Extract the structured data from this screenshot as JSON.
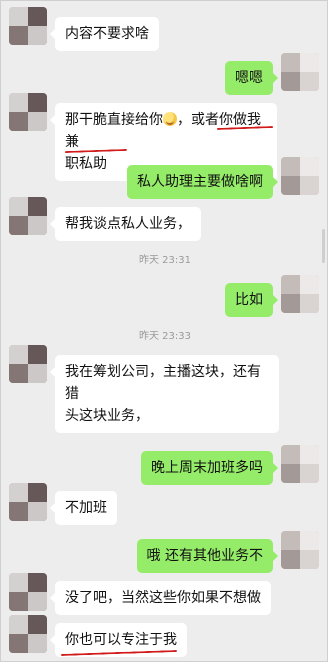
{
  "messages": [
    {
      "text": "内容不要求啥"
    },
    {
      "text": "嗯嗯"
    },
    {
      "line1_before_emoji": "那干脆直接给你",
      "line1_after_emoji": "，或者你做我兼",
      "line2": "职私助"
    },
    {
      "text": "私人助理主要做啥啊"
    },
    {
      "text": "帮我谈点私人业务，"
    },
    {
      "time": "昨天 23:31"
    },
    {
      "text": "比如"
    },
    {
      "time": "昨天 23:33"
    },
    {
      "line1": "我在筹划公司，主播这块，还有猎",
      "line2": "头这块业务，"
    },
    {
      "text": "晚上周末加班多吗"
    },
    {
      "text": "不加班"
    },
    {
      "text": "哦 还有其他业务不"
    },
    {
      "line1": "没了吧，当然这些你如果不想做",
      "line2": "你也可以专注于我"
    }
  ],
  "colors": {
    "incoming_bubble": "#ffffff",
    "outgoing_bubble": "#95ec69",
    "background": "#ededed",
    "underline": "#d11a1a",
    "time_text": "#9a9a9a"
  }
}
